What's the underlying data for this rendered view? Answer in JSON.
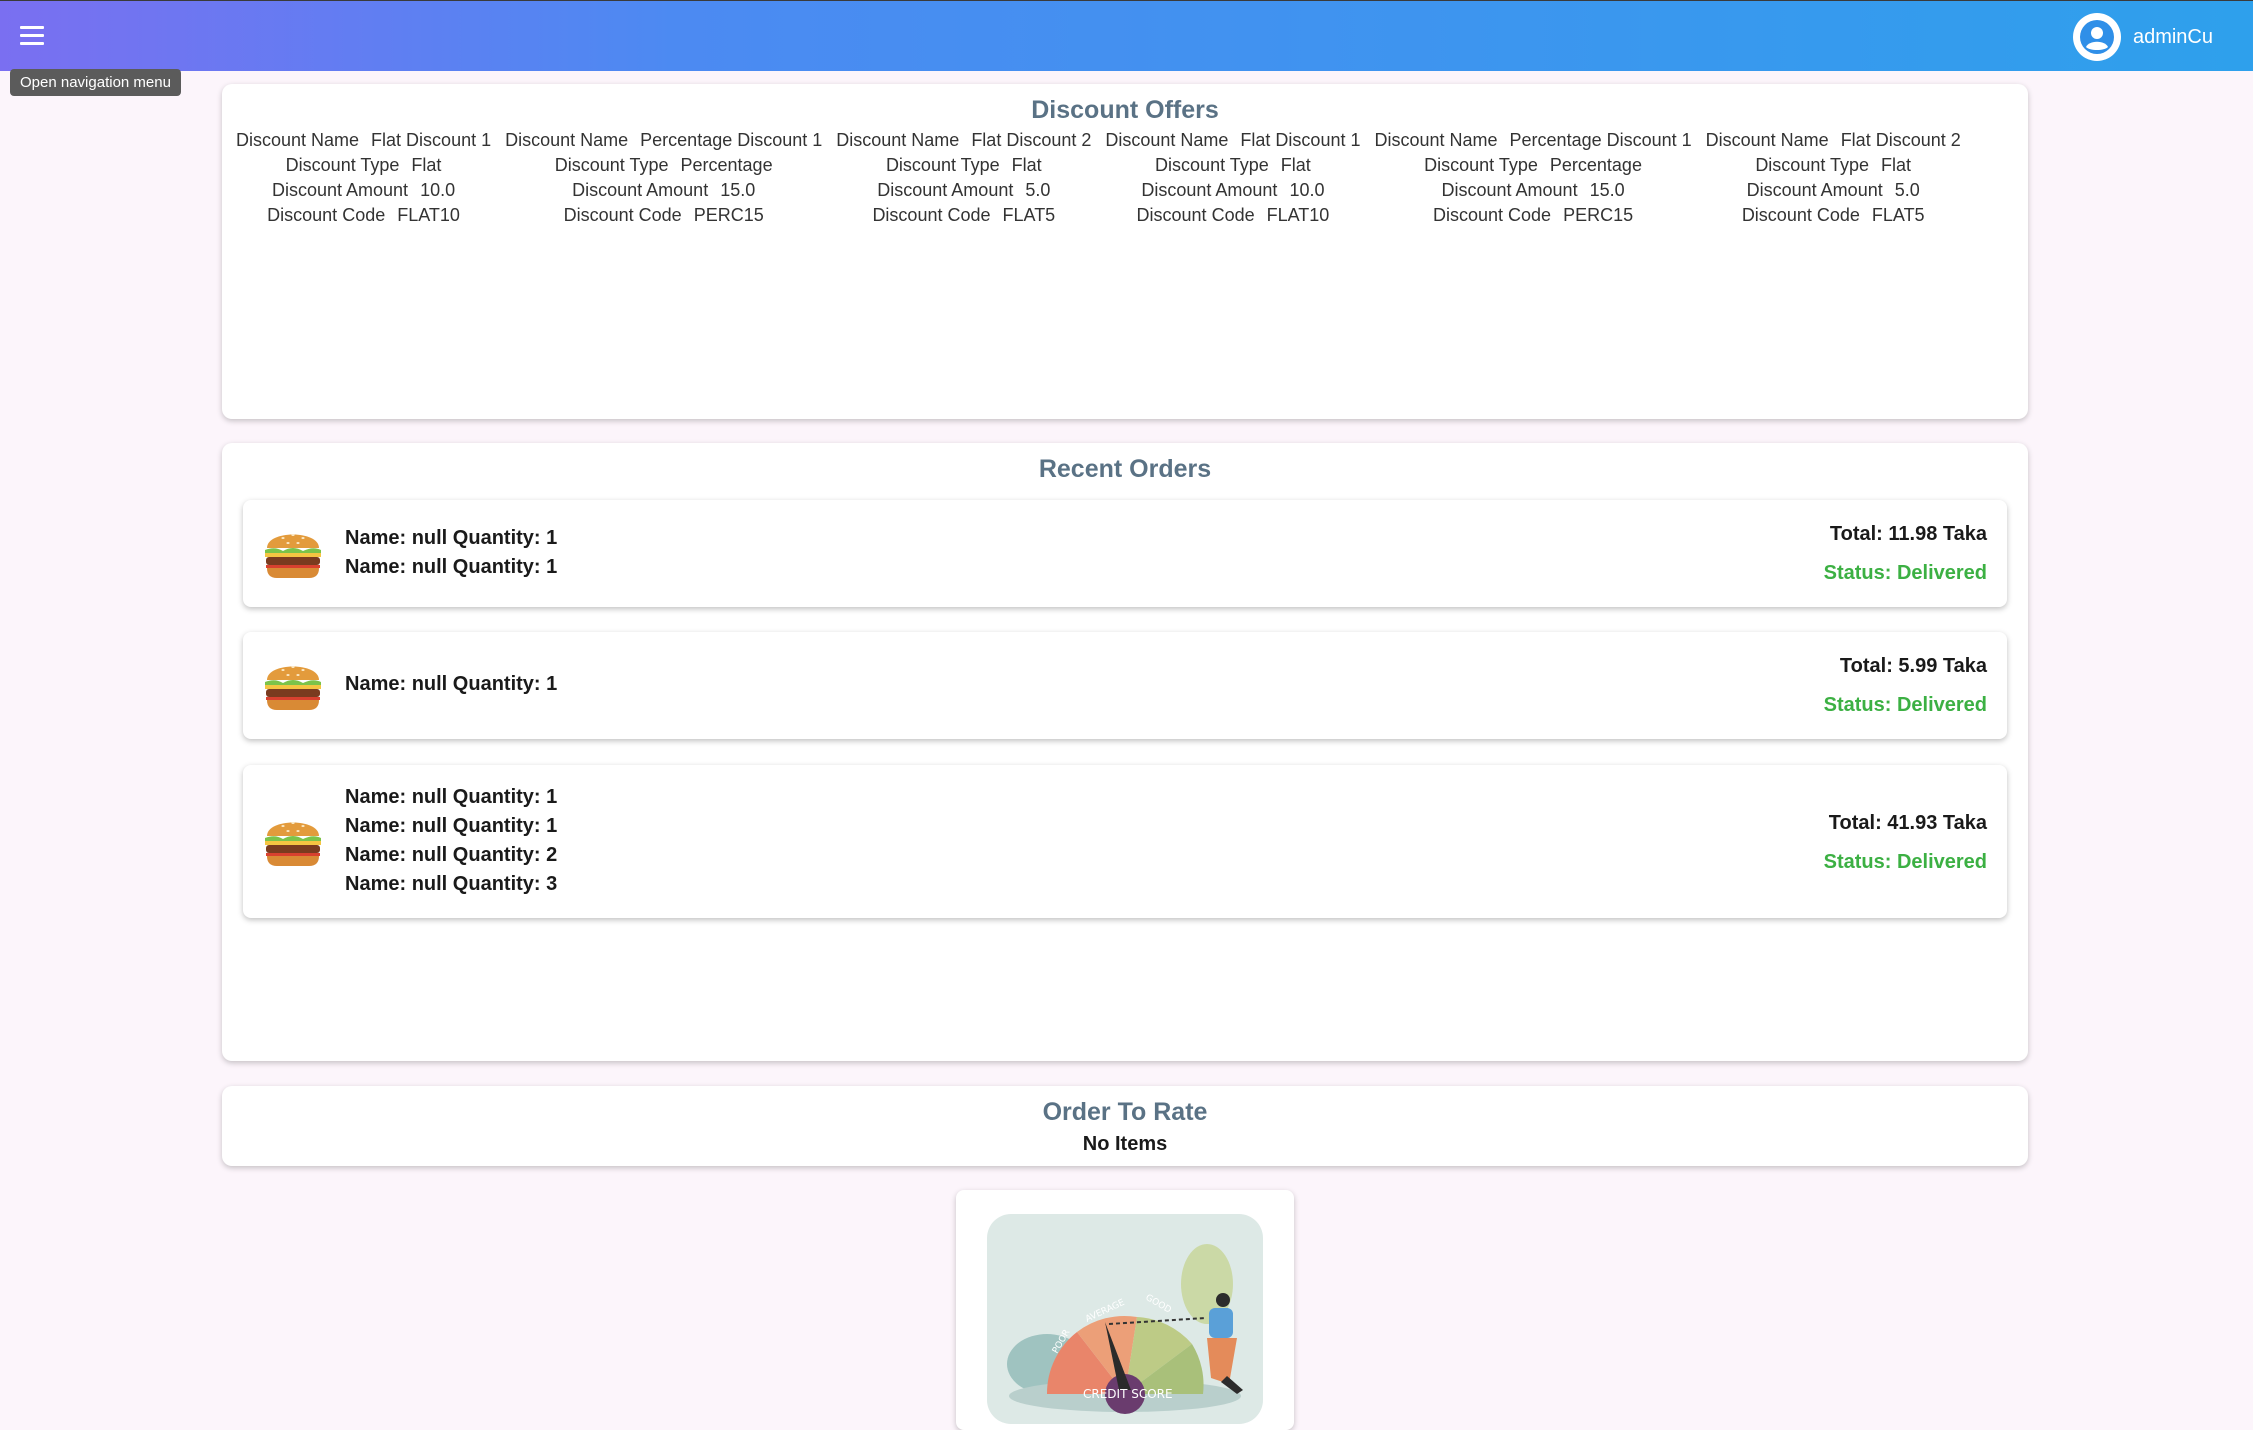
{
  "header": {
    "menu_tooltip": "Open navigation menu",
    "user_name": "adminCu"
  },
  "offers": {
    "title": "Discount Offers",
    "labels": {
      "name": "Discount Name",
      "type": "Discount Type",
      "amount": "Discount Amount",
      "code": "Discount Code"
    },
    "items": [
      {
        "name": "Flat Discount 1",
        "type": "Flat",
        "amount": "10.0",
        "code": "FLAT10"
      },
      {
        "name": "Percentage Discount 1",
        "type": "Percentage",
        "amount": "15.0",
        "code": "PERC15"
      },
      {
        "name": "Flat Discount 2",
        "type": "Flat",
        "amount": "5.0",
        "code": "FLAT5"
      },
      {
        "name": "Flat Discount 1",
        "type": "Flat",
        "amount": "10.0",
        "code": "FLAT10"
      },
      {
        "name": "Percentage Discount 1",
        "type": "Percentage",
        "amount": "15.0",
        "code": "PERC15"
      },
      {
        "name": "Flat Discount 2",
        "type": "Flat",
        "amount": "5.0",
        "code": "FLAT5"
      }
    ]
  },
  "orders": {
    "title": "Recent Orders",
    "list": [
      {
        "lines": [
          "Name: null Quantity: 1",
          "Name: null Quantity: 1"
        ],
        "total": "Total: 11.98 Taka",
        "status": "Status: Delivered"
      },
      {
        "lines": [
          "Name: null Quantity: 1"
        ],
        "total": "Total: 5.99 Taka",
        "status": "Status: Delivered"
      },
      {
        "lines": [
          "Name: null Quantity: 1",
          "Name: null Quantity: 1",
          "Name: null Quantity: 2",
          "Name: null Quantity: 3"
        ],
        "total": "Total: 41.93 Taka",
        "status": "Status: Delivered"
      }
    ]
  },
  "rate": {
    "title": "Order To Rate",
    "empty": "No Items"
  },
  "score_image": {
    "labels": [
      "POOR",
      "AVERAGE",
      "GOOD",
      "CREDIT SCORE"
    ]
  },
  "colors": {
    "title": "#5a7285",
    "status": "#3cb043",
    "appbar_start": "#7a6ff1",
    "appbar_end": "#2ea0ec"
  },
  "icons": {
    "menu": "menu-icon",
    "account": "account-circle-icon",
    "order": "burger-icon"
  }
}
